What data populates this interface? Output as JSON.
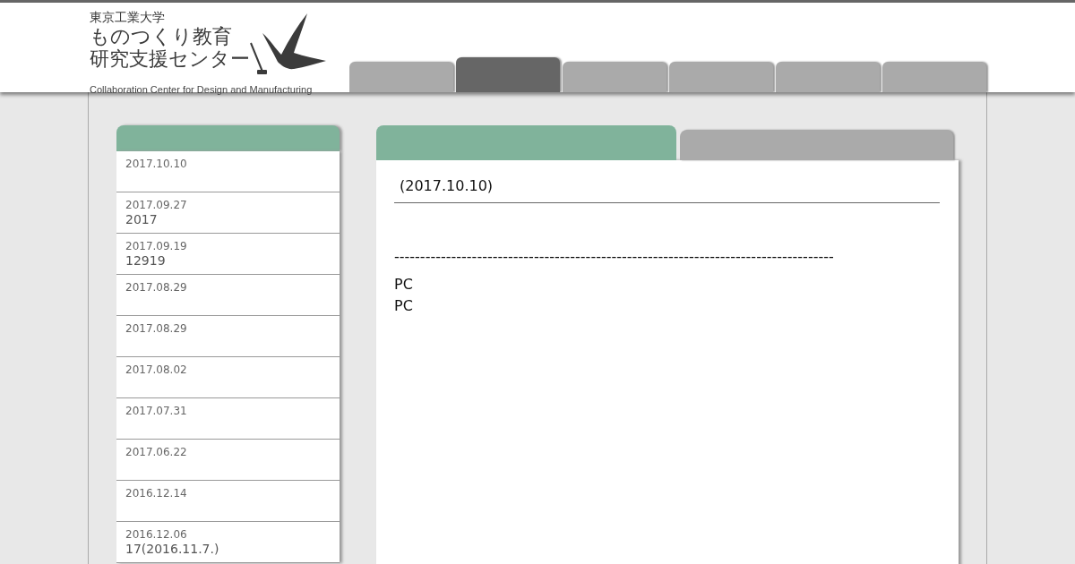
{
  "header": {
    "logo": {
      "university": "東京工業大学",
      "title_lines": [
        "ものつくり教育",
        "研究支援センター"
      ],
      "english": "Collaboration Center for Design and Manufacturing"
    },
    "nav_tabs": [
      {
        "selected": false
      },
      {
        "selected": true
      },
      {
        "selected": false
      },
      {
        "selected": false
      },
      {
        "selected": false
      },
      {
        "selected": false
      }
    ]
  },
  "sidebar": {
    "items": [
      {
        "date": "2017.10.10"
      },
      {
        "date": "2017.09.27",
        "text": "2017"
      },
      {
        "date": "2017.09.19",
        "text": "12919"
      },
      {
        "date": "2017.08.29"
      },
      {
        "date": "2017.08.29"
      },
      {
        "date": "2017.08.02"
      },
      {
        "date": "2017.07.31"
      },
      {
        "date": "2017.06.22"
      },
      {
        "date": "2016.12.14"
      },
      {
        "date": "2016.12.06",
        "text": "17(2016.11.7.)"
      }
    ]
  },
  "main": {
    "tabs": [
      {
        "selected": true
      },
      {
        "selected": false
      }
    ],
    "heading": "(2017.10.10)",
    "paragraphs": [
      [
        "-------------------------------------------------------------------------------------"
      ],
      [
        "PC",
        "PC"
      ]
    ]
  }
}
